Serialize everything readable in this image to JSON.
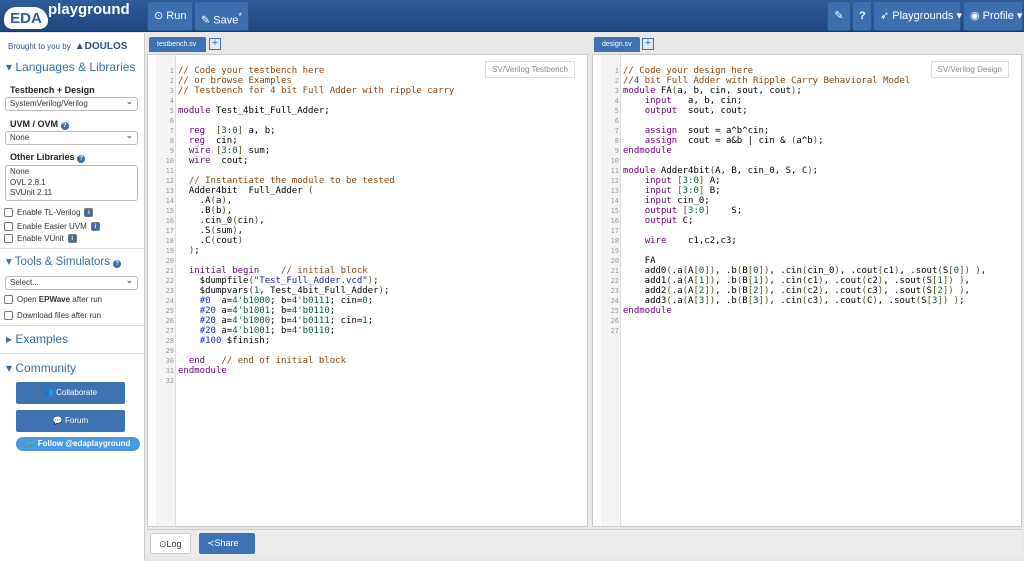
{
  "header": {
    "logo_left": "EDA",
    "logo_right": "playground",
    "run": "Run",
    "save": "Save",
    "save_marker": "*",
    "playgrounds": "Playgrounds",
    "profile": "Profile"
  },
  "sidebar": {
    "brought": "Brought to you by",
    "brand": "DOULOS",
    "languages": "Languages & Libraries",
    "tb_design": "Testbench + Design",
    "tb_design_value": "SystemVerilog/Verilog",
    "uvm": "UVM / OVM",
    "uvm_value": "None",
    "other": "Other Libraries",
    "libraries": [
      "None",
      "OVL 2.8.1",
      "SVUnit 2.11"
    ],
    "checks": [
      "Enable TL-Verilog",
      "Enable Easier UVM",
      "Enable VUnit"
    ],
    "tools": "Tools & Simulators",
    "tools_value": "Select...",
    "epwave_pre": "Open ",
    "epwave_bold": "EPWave",
    "epwave_post": " after run",
    "download": "Download files after run",
    "examples": "Examples",
    "community": "Community",
    "collaborate": "Collaborate",
    "forum": "Forum",
    "follow": "Follow @edaplayground"
  },
  "left": {
    "tab": "testbench.sv",
    "mode": "SV/Verilog Testbench",
    "lines": [
      "// Code your testbench here",
      "// or browse Examples",
      "// Testbench for 4 bit Full Adder with ripple carry",
      "",
      "module Test_4bit_Full_Adder;",
      "",
      "  reg  [3:0] a, b;",
      "  reg  cin;",
      "  wire [3:0] sum;",
      "  wire  cout;",
      "",
      "  // Instantiate the module to be tested",
      "  Adder4bit  Full_Adder (",
      "    .A(a),",
      "    .B(b),",
      "    .cin_0(cin),",
      "    .S(sum),",
      "    .C(cout)",
      "  );",
      "",
      "  initial begin    // initial block",
      "    $dumpfile(\"Test_Full_Adder.vcd\");",
      "    $dumpvars(1, Test_4bit_Full_Adder);",
      "    #0  a=4'b1000; b=4'b0111; cin=0;",
      "    #20 a=4'b1001; b=4'b0110;",
      "    #20 a=4'b1000; b=4'b0111; cin=1;",
      "    #20 a=4'b1001; b=4'b0110;",
      "    #100 $finish;",
      "",
      "  end   // end of initial block",
      "endmodule",
      ""
    ]
  },
  "right": {
    "tab": "design.sv",
    "mode": "SV/Verilog Design",
    "lines": [
      "// Code your design here",
      "//4 bit Full Adder with Ripple Carry Behavioral Model",
      "module FA(a, b, cin, sout, cout);",
      "    input   a, b, cin;",
      "    output  sout, cout;",
      "",
      "    assign  sout = a^b^cin;",
      "    assign  cout = a&b | cin & (a^b);",
      "endmodule",
      "",
      "module Adder4bit(A, B, cin_0, S, C);",
      "    input [3:0] A;",
      "    input [3:0] B;",
      "    input cin_0;",
      "    output [3:0]    S;",
      "    output C;",
      "",
      "    wire    c1,c2,c3;",
      "",
      "    FA",
      "    add0(.a(A[0]), .b(B[0]), .cin(cin_0), .cout(c1), .sout(S[0]) ),",
      "    add1(.a(A[1]), .b(B[1]), .cin(c1), .cout(c2), .sout(S[1]) ),",
      "    add2(.a(A[2]), .b(B[2]), .cin(c2), .cout(c3), .sout(S[2]) ),",
      "    add3(.a(A[3]), .b(B[3]), .cin(c3), .cout(C), .sout(S[3]) );",
      "endmodule",
      "",
      ""
    ]
  },
  "footer": {
    "log": "Log",
    "share": "Share"
  }
}
